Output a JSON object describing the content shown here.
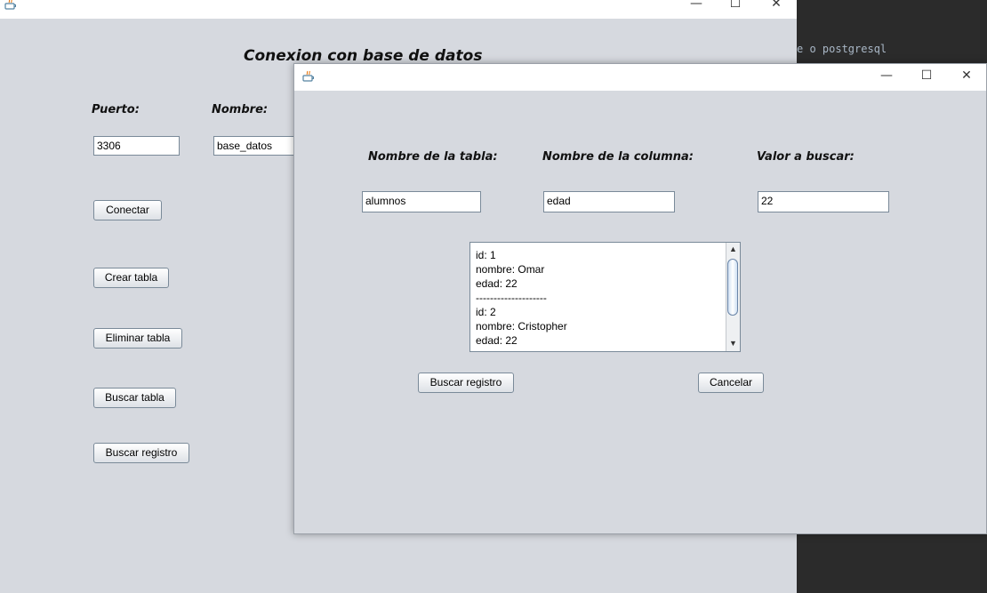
{
  "background_ide": {
    "code_fragment": "e o postgresql"
  },
  "main_window": {
    "title_controls": {
      "minimize": "—",
      "maximize": "☐",
      "close": "✕"
    },
    "heading": "Conexion con base de datos",
    "labels": {
      "port": "Puerto:",
      "name": "Nombre:"
    },
    "fields": {
      "port": "3306",
      "name": "base_datos"
    },
    "buttons": {
      "connect": "Conectar",
      "create_table": "Crear tabla",
      "delete_table": "Eliminar tabla",
      "search_table": "Buscar tabla",
      "search_record": "Buscar registro"
    }
  },
  "dialog": {
    "title_controls": {
      "minimize": "—",
      "maximize": "☐",
      "close": "✕"
    },
    "labels": {
      "table_name": "Nombre de la tabla:",
      "column_name": "Nombre de la columna:",
      "search_value": "Valor a buscar:"
    },
    "fields": {
      "table_name": "alumnos",
      "column_name": "edad",
      "search_value": "22"
    },
    "results": [
      "id: 1",
      "nombre: Omar",
      "edad: 22",
      "--------------------",
      "id: 2",
      "nombre: Cristopher",
      "edad: 22"
    ],
    "buttons": {
      "search_record": "Buscar registro",
      "cancel": "Cancelar"
    }
  },
  "colors": {
    "window_bg": "#d6d9df",
    "titlebar": "#ffffff",
    "ide_bg": "#2b2b2b"
  }
}
